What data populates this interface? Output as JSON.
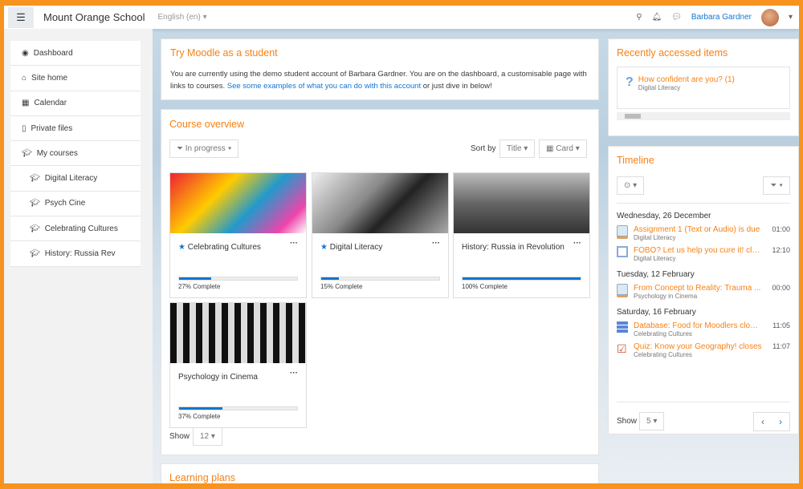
{
  "nav": {
    "menu_icon": "hamburger-icon",
    "site_name": "Mount Orange School",
    "language": "English (en)",
    "user_name": "Barbara Gardner"
  },
  "sidebar": {
    "items": [
      {
        "label": "Dashboard",
        "icon": "dashboard-icon"
      },
      {
        "label": "Site home",
        "icon": "home-icon"
      },
      {
        "label": "Calendar",
        "icon": "calendar-icon"
      },
      {
        "label": "Private files",
        "icon": "file-icon"
      },
      {
        "label": "My courses",
        "icon": "graduation-cap-icon"
      },
      {
        "label": "Digital Literacy",
        "icon": "graduation-cap-icon"
      },
      {
        "label": "Psych Cine",
        "icon": "graduation-cap-icon"
      },
      {
        "label": "Celebrating Cultures",
        "icon": "graduation-cap-icon"
      },
      {
        "label": "History: Russia Rev",
        "icon": "graduation-cap-icon"
      }
    ]
  },
  "intro": {
    "title": "Try Moodle as a student",
    "text1": "You are currently using the demo student account of Barbara Gardner. You are on the dashboard, a customisable page with links to courses. ",
    "link": "See some examples of what you can do with this account",
    "text2": " or just dive in below!"
  },
  "overview": {
    "title": "Course overview",
    "filter": "In progress",
    "sort_label": "Sort by",
    "sort": "Title",
    "view": "Card",
    "show_label": "Show",
    "show": "12",
    "courses": [
      {
        "name": "Celebrating Cultures",
        "starred": true,
        "progress": 27,
        "progress_label": "27% Complete"
      },
      {
        "name": "Digital Literacy",
        "starred": true,
        "progress": 15,
        "progress_label": "15% Complete"
      },
      {
        "name": "History: Russia in Revolution",
        "starred": false,
        "progress": 100,
        "progress_label": "100% Complete"
      },
      {
        "name": "Psychology in Cinema",
        "starred": false,
        "progress": 37,
        "progress_label": "37% Complete"
      }
    ]
  },
  "learning_plans": {
    "title": "Learning plans"
  },
  "recent": {
    "title": "Recently accessed items",
    "item": "How confident are you? (1)",
    "course": "Digital Literacy"
  },
  "timeline": {
    "title": "Timeline",
    "show_label": "Show",
    "show": "5",
    "groups": [
      {
        "date": "Wednesday, 26 December",
        "events": [
          {
            "title": "Assignment 1 (Text or Audio) is due",
            "course": "Digital Literacy",
            "time": "01:00",
            "icon": "assignment-icon"
          },
          {
            "title": "FOBO? Let us help you cure it! clo...",
            "course": "Digital Literacy",
            "time": "12:10",
            "icon": "choice-icon"
          }
        ]
      },
      {
        "date": "Tuesday, 12 February",
        "events": [
          {
            "title": "From Concept to Reality: Trauma ...",
            "course": "Psychology in Cinema",
            "time": "00:00",
            "icon": "assignment-icon"
          }
        ]
      },
      {
        "date": "Saturday, 16 February",
        "events": [
          {
            "title": "Database: Food for Moodlers closes",
            "course": "Celebrating Cultures",
            "time": "11:05",
            "icon": "database-icon"
          },
          {
            "title": "Quiz: Know your Geography! closes",
            "course": "Celebrating Cultures",
            "time": "11:07",
            "icon": "quiz-icon"
          }
        ]
      }
    ]
  }
}
